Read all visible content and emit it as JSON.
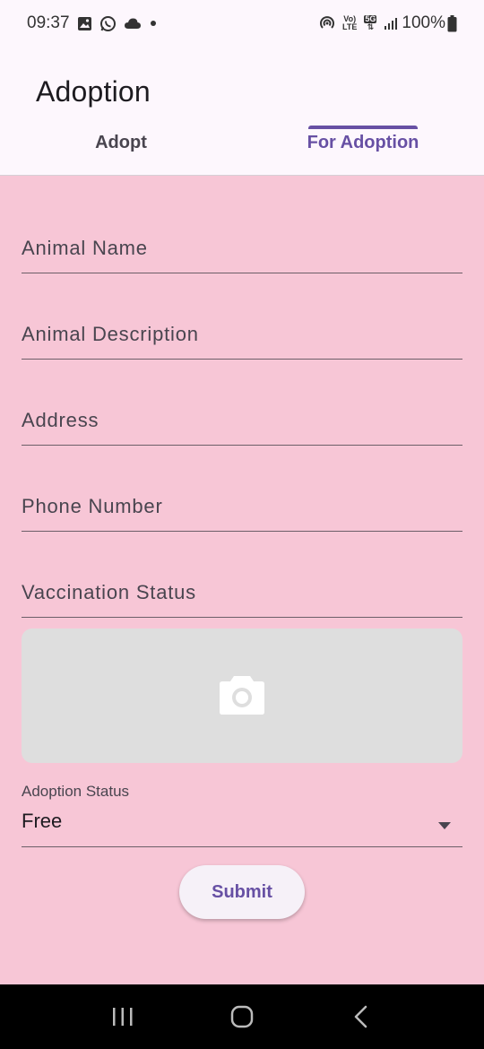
{
  "status_bar": {
    "time": "09:37",
    "battery": "100%",
    "left_icons": [
      "image-icon",
      "whatsapp-icon",
      "cloud-icon",
      "dot-icon"
    ],
    "right_icons": [
      "hotspot-icon",
      "volte-icon",
      "5g-icon",
      "signal-icon",
      "battery-icon"
    ],
    "volte_top": "Vo)",
    "volte_bottom": "LTE",
    "net_top": "5G",
    "net_bottom": "⇅"
  },
  "app_bar": {
    "title": "Adoption"
  },
  "tabs": [
    {
      "label": "Adopt",
      "selected": false
    },
    {
      "label": "For Adoption",
      "selected": true
    }
  ],
  "form": {
    "fields": [
      {
        "placeholder": "Animal Name",
        "value": ""
      },
      {
        "placeholder": "Animal Description",
        "value": ""
      },
      {
        "placeholder": "Address",
        "value": ""
      },
      {
        "placeholder": "Phone Number",
        "value": ""
      },
      {
        "placeholder": "Vaccination Status",
        "value": ""
      }
    ],
    "image_picker_icon": "camera-icon",
    "adoption_status": {
      "label": "Adoption Status",
      "value": "Free"
    },
    "submit_label": "Submit"
  },
  "nav_bar": {
    "buttons": [
      "recent-apps-icon",
      "home-icon",
      "back-icon"
    ]
  },
  "colors": {
    "accent": "#6750a4",
    "background": "#f7c6d6",
    "header": "#fdf7fd",
    "image_picker": "#dedede"
  }
}
